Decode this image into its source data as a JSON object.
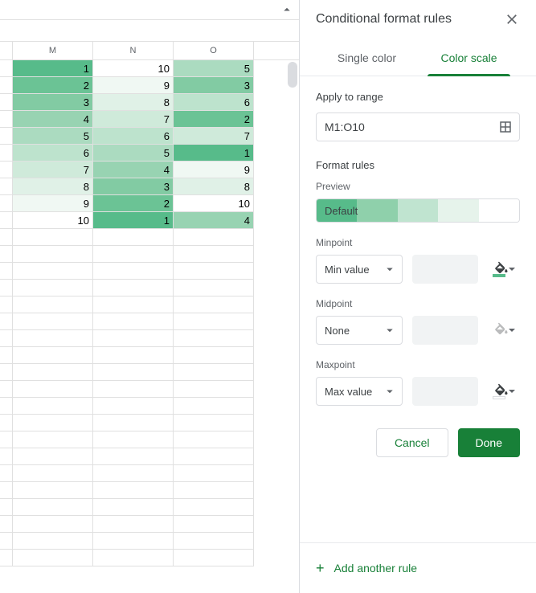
{
  "grid": {
    "columns": [
      "M",
      "N",
      "O"
    ],
    "rows": [
      [
        1,
        10,
        5
      ],
      [
        2,
        9,
        3
      ],
      [
        3,
        8,
        6
      ],
      [
        4,
        7,
        2
      ],
      [
        5,
        6,
        7
      ],
      [
        6,
        5,
        1
      ],
      [
        7,
        4,
        9
      ],
      [
        8,
        3,
        8
      ],
      [
        9,
        2,
        10
      ],
      [
        10,
        1,
        4
      ]
    ],
    "scale_colors": {
      "1": "#57bb8a",
      "2": "#6bc395",
      "3": "#82cba3",
      "4": "#98d3b2",
      "5": "#abdbc0",
      "6": "#bde3cd",
      "7": "#cfeada",
      "8": "#e0f1e7",
      "9": "#f0f8f3",
      "10": "#ffffff"
    }
  },
  "panel": {
    "title": "Conditional format rules",
    "tabs": {
      "single": "Single color",
      "scale": "Color scale"
    },
    "apply_label": "Apply to range",
    "range": "M1:O10",
    "format_rules_label": "Format rules",
    "preview_label": "Preview",
    "preview_text": "Default",
    "preview_segments": [
      "#57bb8a",
      "#8fd0ab",
      "#c0e4d0",
      "#e6f3eb",
      "#ffffff"
    ],
    "minpoint_label": "Minpoint",
    "midpoint_label": "Midpoint",
    "maxpoint_label": "Maxpoint",
    "min_select": "Min value",
    "mid_select": "None",
    "max_select": "Max value",
    "min_color": "#57bb8a",
    "max_color": "#ffffff",
    "cancel": "Cancel",
    "done": "Done",
    "add_rule": "Add another rule"
  }
}
